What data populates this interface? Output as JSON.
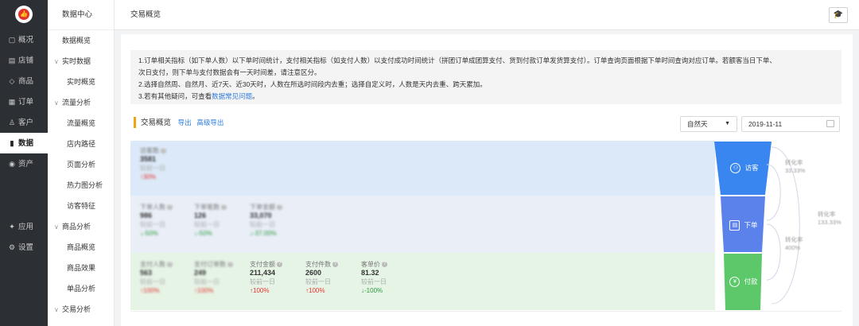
{
  "rail": {
    "items": [
      {
        "icon": "▢",
        "icon_name": "overview-icon",
        "label": "概况"
      },
      {
        "icon": "▤",
        "icon_name": "shop-icon",
        "label": "店铺"
      },
      {
        "icon": "◇",
        "icon_name": "tag-icon",
        "label": "商品"
      },
      {
        "icon": "▦",
        "icon_name": "order-icon",
        "label": "订单"
      },
      {
        "icon": "♙",
        "icon_name": "customer-icon",
        "label": "客户"
      },
      {
        "icon": "▮",
        "icon_name": "bar-chart-icon",
        "label": "数据",
        "active": true
      },
      {
        "icon": "◉",
        "icon_name": "asset-icon",
        "label": "资产"
      }
    ],
    "bottom": [
      {
        "icon": "✦",
        "icon_name": "apps-icon",
        "label": "应用"
      },
      {
        "icon": "⚙",
        "icon_name": "settings-icon",
        "label": "设置"
      }
    ]
  },
  "second_nav": {
    "header": "数据中心",
    "items": [
      {
        "label": "数据概览",
        "type": "item"
      },
      {
        "label": "实时数据",
        "type": "group"
      },
      {
        "label": "实时概览",
        "type": "sub"
      },
      {
        "label": "流量分析",
        "type": "group"
      },
      {
        "label": "流量概览",
        "type": "sub"
      },
      {
        "label": "店内路径",
        "type": "sub"
      },
      {
        "label": "页面分析",
        "type": "sub"
      },
      {
        "label": "热力图分析",
        "type": "sub"
      },
      {
        "label": "访客特征",
        "type": "sub"
      },
      {
        "label": "商品分析",
        "type": "group"
      },
      {
        "label": "商品概览",
        "type": "sub"
      },
      {
        "label": "商品效果",
        "type": "sub"
      },
      {
        "label": "单品分析",
        "type": "sub"
      },
      {
        "label": "交易分析",
        "type": "group"
      }
    ]
  },
  "top": {
    "title": "交易概览",
    "hat_icon": "graduation-cap-icon"
  },
  "notice": {
    "line1": "1.订单相关指标（如下单人数）以下单时间统计，支付相关指标（如支付人数）以支付成功时间统计（拼团订单成团算支付、货到付款订单发货算支付）。订单查询页面根据下单时间查询对应订单。若额客当日下单、",
    "line2": "次日支付，则下单与支付数据会有一天时间差，请注意区分。",
    "line3": "2.选择自然周、自然月、近7天、近30天时，人数在所选时间段内去重；选择自定义时，人数是天内去重、跨天累加。",
    "line4_prefix": "3.若有其他疑问，可查看",
    "line4_link": "数据常见问题",
    "line4_suffix": "。"
  },
  "section": {
    "title": "交易概览",
    "export": "导出",
    "advanced_export": "高级导出",
    "period": "自然天",
    "date": "2019-11-11"
  },
  "visitor": {
    "metrics": [
      {
        "label": "访客数",
        "value": "3581",
        "cmp": "较前一日",
        "chg": "↑30%",
        "dir": "up",
        "blur": true
      }
    ]
  },
  "order": {
    "metrics": [
      {
        "label": "下单人数",
        "value": "986",
        "cmp": "较前一日",
        "chg": "↓-50%",
        "dir": "down",
        "blur": true
      },
      {
        "label": "下单笔数",
        "value": "126",
        "cmp": "较前一日",
        "chg": "↓-50%",
        "dir": "down",
        "blur": true
      },
      {
        "label": "下单金额",
        "value": "33,070",
        "cmp": "较前一日",
        "chg": "↓-37.00%",
        "dir": "down",
        "blur": true
      }
    ]
  },
  "pay": {
    "metrics": [
      {
        "label": "支付人数",
        "value": "563",
        "cmp": "较前一日",
        "chg": "↑100%",
        "dir": "up",
        "blur": true
      },
      {
        "label": "支付订单数",
        "value": "249",
        "cmp": "较前一日",
        "chg": "↑100%",
        "dir": "up",
        "blur": true
      },
      {
        "label": "支付金额",
        "value": "211,434",
        "cmp": "较前一日",
        "chg": "↑100%",
        "dir": "up",
        "blur": false
      },
      {
        "label": "支付件数",
        "value": "2600",
        "cmp": "较前一日",
        "chg": "↑100%",
        "dir": "up",
        "blur": false
      },
      {
        "label": "客单价",
        "value": "81.32",
        "cmp": "较前一日",
        "chg": "↓-100%",
        "dir": "down",
        "blur": false
      }
    ]
  },
  "funnel": {
    "visitor_label": "访客",
    "order_label": "下单",
    "pay_label": "付款",
    "colors": {
      "visitor": "#3a86f0",
      "order": "#5a82ea",
      "pay": "#5cc86a"
    }
  },
  "conversion": {
    "a_label": "转化率",
    "a_value": "33.33%",
    "b_label": "转化率",
    "b_value": "400%",
    "c_label": "转化率",
    "c_value": "133.33%"
  }
}
